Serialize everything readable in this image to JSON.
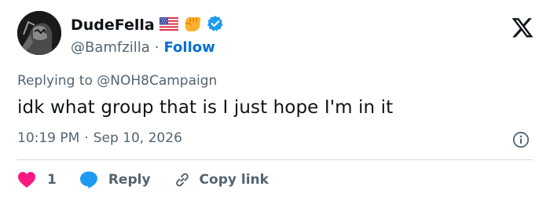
{
  "author": {
    "display_name": "DudeFella",
    "handle": "@Bamfzilla",
    "separator": "·",
    "follow_label": "Follow",
    "emojis": [
      "us-flag",
      "fist-bump"
    ],
    "verified": true
  },
  "tweet": {
    "replying_prefix": "Replying to",
    "replying_to": "@NOH8Campaign",
    "text": "idk what group that is I just hope I'm in it",
    "time": "10:19 PM",
    "dot": "·",
    "date": "Sep 10, 2026"
  },
  "actions": {
    "like_count": "1",
    "reply_label": "Reply",
    "copy_label": "Copy link"
  },
  "colors": {
    "accent": "#1d9bf0",
    "follow": "#006fd6",
    "like": "#f91880",
    "muted": "#536471",
    "text": "#0f1419"
  }
}
